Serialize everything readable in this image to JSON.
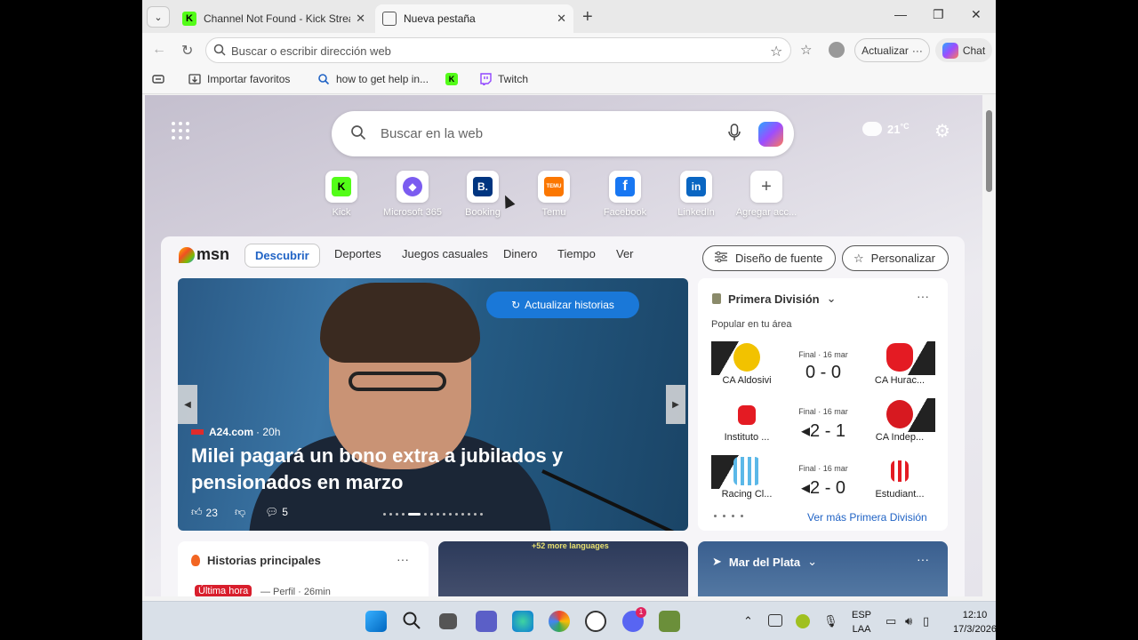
{
  "browser": {
    "tab_search_icon": "chevron-down-icon",
    "tabs": [
      {
        "title": "Channel Not Found - Kick Streami",
        "close": "✕",
        "icon": "kick-icon"
      },
      {
        "title": "Nueva pestaña",
        "close": "✕",
        "icon": "newtab-icon"
      }
    ],
    "new_tab": "+",
    "window_controls": {
      "minimize": "—",
      "maximize": "❐",
      "close": "✕"
    },
    "address_placeholder": "Buscar o escribir dirección web",
    "actualizar_label": "Actualizar",
    "actualizar_more": "···",
    "chat_label": "Chat",
    "bookmarks": [
      {
        "label": "Importar favoritos",
        "icon": "import-icon"
      },
      {
        "label": "how to get help in...",
        "icon": "search-icon"
      },
      {
        "label": "",
        "icon": "kick-icon"
      },
      {
        "label": "Twitch",
        "icon": "twitch-icon"
      }
    ]
  },
  "newtab": {
    "search_placeholder": "Buscar en la web",
    "weather_temp": "21",
    "weather_unit": "°C",
    "quick_links": [
      {
        "label": "Kick",
        "text": "K",
        "color": "#53fc18"
      },
      {
        "label": "Microsoft 365",
        "text": "◆",
        "color": "#7b5cf0"
      },
      {
        "label": "Booking",
        "text": "B.",
        "color": "#003580"
      },
      {
        "label": "Temu",
        "text": "TEMU",
        "color": "#fb7701"
      },
      {
        "label": "Facebook",
        "text": "f",
        "color": "#1877f2"
      },
      {
        "label": "LinkedIn",
        "text": "in",
        "color": "#0a66c2"
      },
      {
        "label": "Agregar acc...",
        "text": "+",
        "color": "#ffffff"
      }
    ]
  },
  "msn": {
    "logo": "msn",
    "tabs": [
      "Descubrir",
      "Deportes",
      "Juegos casuales",
      "Dinero",
      "Tiempo",
      "Ver"
    ],
    "feed_design": "Diseño de fuente",
    "personalize": "Personalizar",
    "hero": {
      "refresh": "Actualizar historias",
      "source": "A24.com",
      "age": "· 20h",
      "title": "Milei pagará un bono extra a jubilados y pensionados en marzo",
      "likes": "23",
      "comments": "5",
      "active_slide": 4,
      "slide_count": 15
    },
    "sports": {
      "league": "Primera División",
      "more": "···",
      "subtitle": "Popular en tu área",
      "matches": [
        {
          "home": "CA Aldosivi",
          "away": "CA Hurac...",
          "status": "Final · 16 mar",
          "score": "0 - 0",
          "c1": "#f2c200",
          "c2": "#e41b23"
        },
        {
          "home": "Instituto ...",
          "away": "CA Indep...",
          "status": "Final · 16 mar",
          "score": "◂2 - 1",
          "c1": "#e41b23",
          "c2": "#d71920"
        },
        {
          "home": "Racing Cl...",
          "away": "Estudiant...",
          "status": "Final · 16 mar",
          "score": "◂2 - 0",
          "c1": "#5bb8e8",
          "c2": "#e41b23"
        }
      ],
      "see_more": "Ver más Primera División"
    },
    "top_stories": {
      "title": "Historias principales",
      "more": "···",
      "badge": "Última hora",
      "source": "— Perfil · 26min"
    },
    "mid_card": {
      "languages": "+52 more languages"
    },
    "weather_card": {
      "location": "Mar del Plata",
      "more": "···"
    }
  },
  "taskbar": {
    "lang": "ESP",
    "lang2": "LAA",
    "time": "12:10",
    "date": "17/3/2026",
    "discord_badge": "1"
  }
}
